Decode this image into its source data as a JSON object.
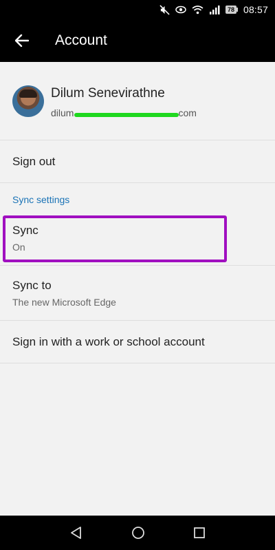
{
  "status_bar": {
    "battery": "78",
    "time": "08:57",
    "icons": [
      "mute-icon",
      "eye-icon",
      "wifi-icon",
      "signal-icon",
      "battery-icon"
    ]
  },
  "app_bar": {
    "back_icon": "arrow-left-icon",
    "title": "Account"
  },
  "profile": {
    "name": "Dilum Senevirathne",
    "email_start": "dilum",
    "email_end": "com"
  },
  "menu": {
    "sign_out": "Sign out",
    "sync_section": "Sync settings",
    "sync": {
      "label": "Sync",
      "value": "On"
    },
    "sync_to": {
      "label": "Sync to",
      "value": "The new Microsoft Edge"
    },
    "work_account": "Sign in with a work or school account"
  },
  "colors": {
    "accent": "#1a73b6",
    "highlight": "#a00fc0",
    "redaction": "#1fd81f"
  },
  "nav_bar": [
    "back-triangle-icon",
    "home-circle-icon",
    "recents-square-icon"
  ]
}
